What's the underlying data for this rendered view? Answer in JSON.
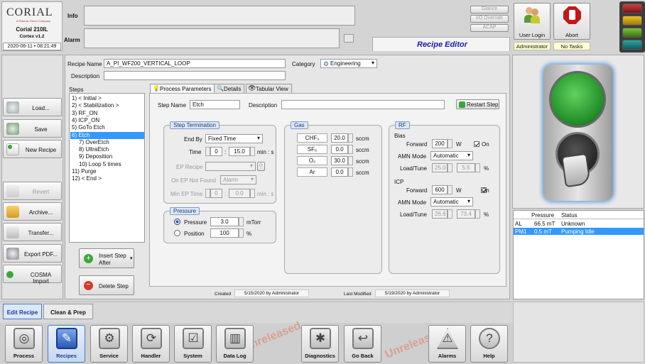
{
  "brand": {
    "logo": "CORIAL",
    "tagline": "A Plasma-Therm Company",
    "model": "Corial 210IL",
    "version": "Cortex v1.2",
    "datetime": "2020-06-11 • 08:21:49"
  },
  "header": {
    "info_label": "Info",
    "alarm_label": "Alarm",
    "glance": "Glance",
    "io_override": "I/O Override",
    "acap": "ACAP",
    "page_title": "Recipe Editor"
  },
  "user": {
    "login_label": "User Login",
    "abort_label": "Abort",
    "role": "Administrator",
    "tasks": "No Tasks"
  },
  "sidebar": {
    "items": [
      "Load...",
      "Save",
      "New Recipe",
      "Revert",
      "Archive...",
      "Transfer...",
      "Export PDF...",
      "COSMA Import"
    ]
  },
  "recipe": {
    "name_label": "Recipe Name",
    "name_value": "A_PI_WF200_VERTICAL_LOOP",
    "category_label": "Category",
    "category_value": "Engineering",
    "description_label": "Description",
    "description_value": ""
  },
  "steps": {
    "label": "Steps",
    "items": [
      "1) < Initial >",
      "2) < Stabilization >",
      "3) RF_ON",
      "4) ICP_ON",
      "5) GoTo Etch",
      "6) Etch",
      "7) OverEtch",
      "8) UltraEtch",
      "9) Deposition",
      "10) Loop 5 times",
      "11) Purge",
      "12) < End >"
    ],
    "selected": 5,
    "insert_label_1": "Insert Step",
    "insert_label_2": "After",
    "delete_label": "Delete Step"
  },
  "tabs": [
    "Process Parameters",
    "Details",
    "Tabular View"
  ],
  "params": {
    "step_name_label": "Step Name",
    "step_name_value": "Etch",
    "description_label": "Description",
    "restart_label": "Restart Step",
    "termination": {
      "title": "Step Termination",
      "endby_label": "End By",
      "endby_value": "Fixed Time",
      "time_label": "Time",
      "time_min": "0",
      "time_sep": ":",
      "time_sec": "15.0",
      "time_unit": "min : s",
      "ep_recipe_label": "EP Recipe",
      "ep_notfound_label": "On EP Not Found",
      "ep_notfound_value": "Alarm",
      "min_ep_label": "Min EP Time",
      "min_ep_min": "0",
      "min_ep_sec": "0.0",
      "min_ep_unit": "min : s"
    },
    "pressure": {
      "title": "Pressure",
      "pressure_label": "Pressure",
      "pressure_value": "3.0",
      "pressure_unit": "mTorr",
      "position_label": "Position",
      "position_value": "100",
      "position_unit": "%"
    },
    "gas": {
      "title": "Gas",
      "rows": [
        {
          "name": "CHF₃",
          "value": "20.0",
          "unit": "sccm"
        },
        {
          "name": "SF₆",
          "value": "0.0",
          "unit": "sccm"
        },
        {
          "name": "O₂",
          "value": "30.0",
          "unit": "sccm"
        },
        {
          "name": "Ar",
          "value": "0.0",
          "unit": "sccm"
        }
      ]
    },
    "rf": {
      "title": "RF",
      "bias": {
        "label": "Bias",
        "forward_label": "Forward",
        "forward_value": "200",
        "forward_unit": "W",
        "on_label": "On",
        "amn_label": "AMN Mode",
        "amn_value": "Automatic",
        "loadtune_label": "Load/Tune",
        "load_value": "25.0",
        "tune_value": "5.5",
        "lt_unit": "%"
      },
      "icp": {
        "label": "ICP",
        "forward_label": "Forward",
        "forward_value": "600",
        "forward_unit": "W",
        "on_label": "On",
        "amn_label": "AMN Mode",
        "amn_value": "Automatic",
        "loadtune_label": "Load/Tune",
        "load_value": "26.6",
        "tune_value": "73.4",
        "lt_unit": "%"
      }
    }
  },
  "footer": {
    "created_label": "Created",
    "created_value": "5/15/2020 by Administrator",
    "modified_label": "Last Modified",
    "modified_value": "5/19/2020 by Administrator"
  },
  "status_table": {
    "headers": [
      "",
      "Pressure",
      "Status"
    ],
    "rows": [
      [
        "AL",
        "66.5 mT",
        "Unknown"
      ],
      [
        "PM1",
        "0.5 mT",
        "Pumping Idle"
      ]
    ]
  },
  "mode_tabs": [
    "Edit Recipe",
    "Clean & Prep"
  ],
  "nav": [
    "Process",
    "Recipes",
    "Service",
    "Handler",
    "System",
    "Data Log",
    "Diagnostics",
    "Go Back",
    "Alarms",
    "Help"
  ],
  "watermark": "Unreleased",
  "colors": {
    "accent": "#1a1aa6",
    "selected": "#3399ff",
    "green": "#2ea83a"
  }
}
